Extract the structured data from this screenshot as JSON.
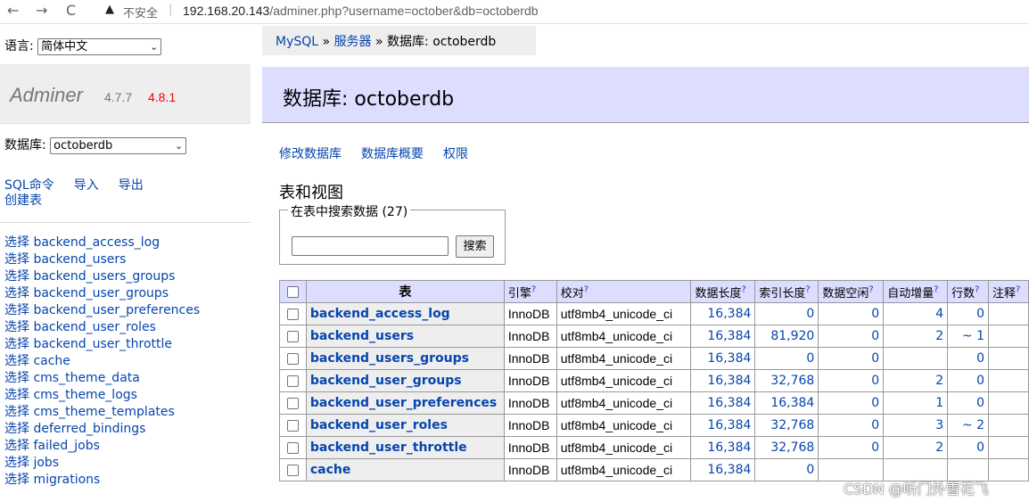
{
  "browser": {
    "back": "←",
    "forward": "→",
    "reload": "C",
    "warn": "▲",
    "insecure": "不安全",
    "separator": "|",
    "url_host": "192.168.20.143",
    "url_path": "/adminer.php?username=october&db=octoberdb"
  },
  "sidebar": {
    "lang_label": "语言:",
    "lang_value": "简体中文",
    "logo_name": "Adminer",
    "version": "4.7.7",
    "new_version": "4.8.1",
    "db_label": "数据库:",
    "db_value": "octoberdb",
    "links": {
      "sql": "SQL命令",
      "import": "导入",
      "export": "导出",
      "create_table": "创建表"
    },
    "table_links": [
      "选择 backend_access_log",
      "选择 backend_users",
      "选择 backend_users_groups",
      "选择 backend_user_groups",
      "选择 backend_user_preferences",
      "选择 backend_user_roles",
      "选择 backend_user_throttle",
      "选择 cache",
      "选择 cms_theme_data",
      "选择 cms_theme_logs",
      "选择 cms_theme_templates",
      "选择 deferred_bindings",
      "选择 failed_jobs",
      "选择 jobs",
      "选择 migrations"
    ]
  },
  "breadcrumb": {
    "driver": "MySQL",
    "sep1": "»",
    "server": "服务器",
    "sep2": "»",
    "current": "数据库: octoberdb"
  },
  "page": {
    "title": "数据库: octoberdb",
    "actions": {
      "alter": "修改数据库",
      "schema": "数据库概要",
      "privileges": "权限"
    },
    "section_title": "表和视图",
    "search_legend": "在表中搜索数据 (27)",
    "search_button": "搜索",
    "search_value": ""
  },
  "table": {
    "headers": {
      "name": "表",
      "engine": "引擎",
      "collation": "校对",
      "data_length": "数据长度",
      "index_length": "索引长度",
      "data_free": "数据空闲",
      "auto_increment": "自动增量",
      "rows": "行数",
      "comment": "注释",
      "help": "?"
    },
    "rows": [
      {
        "name": "backend_access_log",
        "engine": "InnoDB",
        "collation": "utf8mb4_unicode_ci",
        "data_length": "16,384",
        "index_length": "0",
        "data_free": "0",
        "auto_increment": "4",
        "rows": "0"
      },
      {
        "name": "backend_users",
        "engine": "InnoDB",
        "collation": "utf8mb4_unicode_ci",
        "data_length": "16,384",
        "index_length": "81,920",
        "data_free": "0",
        "auto_increment": "2",
        "rows": "~ 1"
      },
      {
        "name": "backend_users_groups",
        "engine": "InnoDB",
        "collation": "utf8mb4_unicode_ci",
        "data_length": "16,384",
        "index_length": "0",
        "data_free": "0",
        "auto_increment": "",
        "rows": "0"
      },
      {
        "name": "backend_user_groups",
        "engine": "InnoDB",
        "collation": "utf8mb4_unicode_ci",
        "data_length": "16,384",
        "index_length": "32,768",
        "data_free": "0",
        "auto_increment": "2",
        "rows": "0"
      },
      {
        "name": "backend_user_preferences",
        "engine": "InnoDB",
        "collation": "utf8mb4_unicode_ci",
        "data_length": "16,384",
        "index_length": "16,384",
        "data_free": "0",
        "auto_increment": "1",
        "rows": "0"
      },
      {
        "name": "backend_user_roles",
        "engine": "InnoDB",
        "collation": "utf8mb4_unicode_ci",
        "data_length": "16,384",
        "index_length": "32,768",
        "data_free": "0",
        "auto_increment": "3",
        "rows": "~ 2"
      },
      {
        "name": "backend_user_throttle",
        "engine": "InnoDB",
        "collation": "utf8mb4_unicode_ci",
        "data_length": "16,384",
        "index_length": "32,768",
        "data_free": "0",
        "auto_increment": "2",
        "rows": "0"
      },
      {
        "name": "cache",
        "engine": "InnoDB",
        "collation": "utf8mb4_unicode_ci",
        "data_length": "16,384",
        "index_length": "0",
        "data_free": "",
        "auto_increment": "",
        "rows": ""
      }
    ]
  },
  "watermark": "CSDN @听门外雪花飞"
}
